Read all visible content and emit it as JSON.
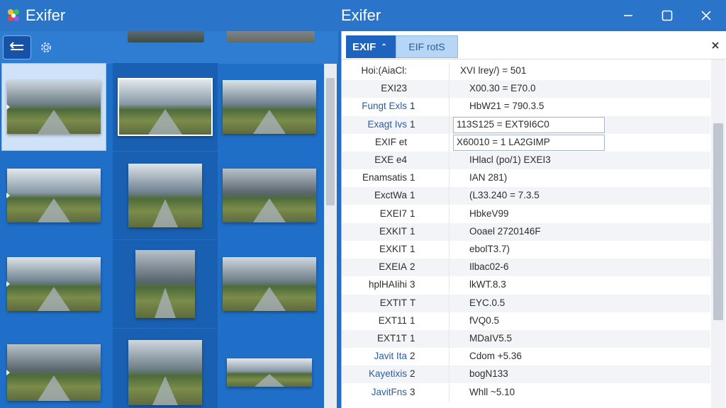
{
  "app": {
    "title_left": "Exifer",
    "title_center": "Exifer"
  },
  "colors": {
    "titlebar": "#2a74c9",
    "accent": "#1e64bf",
    "pane_bg": "#1f6fc8"
  },
  "left": {
    "back_icon": "arrow-left-right-icon",
    "settings_icon": "gear-icon"
  },
  "right": {
    "tab_active": "EXIF",
    "tab_active_chevron": "⌃",
    "tab_secondary": "EIF rotS",
    "rows": [
      {
        "key": "Hoi:(AiaCl:",
        "num": "",
        "value": "XVI lrey/) = 501",
        "blue": false
      },
      {
        "key": "EXI23",
        "num": "",
        "value": "X00.30 = E70.0",
        "blue": false
      },
      {
        "key": "Fungt Exls",
        "num": "1",
        "value": "HbW21 = 790.3.5",
        "blue": true
      },
      {
        "key": "Exagt Ivs",
        "num": "1",
        "value": "113S125 = EXT9I6C0",
        "blue": true,
        "field": true
      },
      {
        "key": "EXIF et",
        "num": "",
        "value": "X60010 = 1 LA2GIMP",
        "blue": false,
        "field": true
      },
      {
        "key": "EXE e4",
        "num": "",
        "value": "IHlacl (po/1) EXEI3",
        "blue": false
      },
      {
        "key": "Enamsatis",
        "num": "1",
        "value": "IAN 281)",
        "blue": false
      },
      {
        "key": "ExctWa",
        "num": "1",
        "value": "(L33.240 = 7.3.5",
        "blue": false
      },
      {
        "key": "EXEI7",
        "num": "1",
        "value": "HbkeV99",
        "blue": false
      },
      {
        "key": "EXKIT",
        "num": "1",
        "value": "Ooael 2720146F",
        "blue": false
      },
      {
        "key": "EXKIT",
        "num": "1",
        "value": "ebolT3.7)",
        "blue": false
      },
      {
        "key": "EXEIA",
        "num": "2",
        "value": "Ilbac02-6",
        "blue": false
      },
      {
        "key": "hplHAIihi",
        "num": "3",
        "value": "lkWT.8.3",
        "blue": false
      },
      {
        "key": "EXTIT",
        "num": "T",
        "value": "EYC.0.5",
        "blue": false
      },
      {
        "key": "EXT11",
        "num": "1",
        "value": "fVQ0.5",
        "blue": false
      },
      {
        "key": "EXT1T",
        "num": "1",
        "value": "MDaIV5.5",
        "blue": false
      },
      {
        "key": "Javit Ita",
        "num": "2",
        "value": "Cdom +5.36",
        "blue": true
      },
      {
        "key": "Kayetixis",
        "num": "2",
        "value": "bogN133",
        "blue": true
      },
      {
        "key": "JavitFns",
        "num": "3",
        "value": "Whll ~5.10",
        "blue": true
      }
    ]
  }
}
